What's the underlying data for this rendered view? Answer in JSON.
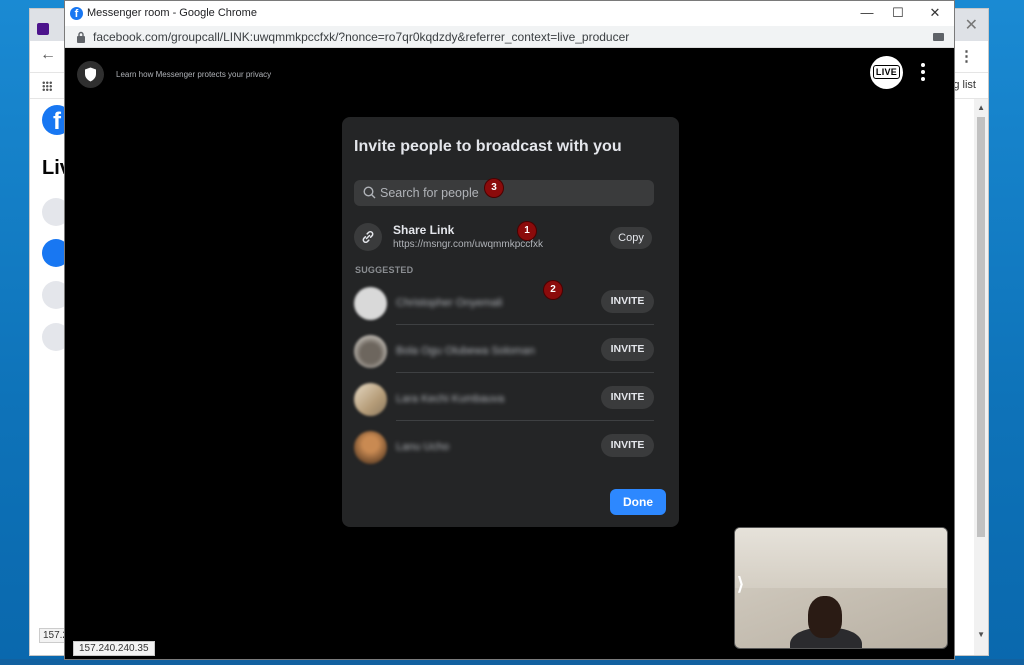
{
  "background_window": {
    "reading_list_fragment": "g list",
    "page_heading_fragment": "Liv",
    "status_fragment": "157.2"
  },
  "window": {
    "title": "Messenger room - Google Chrome",
    "url": "facebook.com/groupcall/LINK:uwqmmkpccfxk/?nonce=ro7qr0kqdzdy&referrer_context=live_producer",
    "controls": {
      "minimize": "—",
      "maximize": "☐",
      "close": "✕"
    }
  },
  "header": {
    "privacy_text": "Learn how Messenger protects your privacy",
    "live_badge": "LIVE"
  },
  "dialog": {
    "title": "Invite people to broadcast with you",
    "search_placeholder": "Search for people",
    "share_link": {
      "title": "Share Link",
      "url": "https://msngr.com/uwqmmkpccfxk",
      "copy_label": "Copy"
    },
    "suggested_label": "SUGGESTED",
    "people": [
      {
        "name": "Christopher Onyemali",
        "invite_label": "INVITE",
        "avatar_color": "#d9d9d9"
      },
      {
        "name": "Bola Ogu Olubewa Soloman",
        "invite_label": "INVITE",
        "avatar_color": "#8a8580"
      },
      {
        "name": "Lara Kechi Kumbauva",
        "invite_label": "INVITE",
        "avatar_color": "#c8b8a0"
      },
      {
        "name": "Lanu Ucho",
        "invite_label": "INVITE",
        "avatar_color": "#9a6a44"
      }
    ],
    "done_label": "Done"
  },
  "annotations": [
    "1",
    "2",
    "3"
  ],
  "selfview": {
    "expand_glyph": "⟩"
  },
  "status_bar": {
    "ip": "157.240.240.35"
  },
  "colors": {
    "accent": "#2d88ff",
    "dialog_bg": "#242526",
    "marker": "#8b0b0b"
  }
}
